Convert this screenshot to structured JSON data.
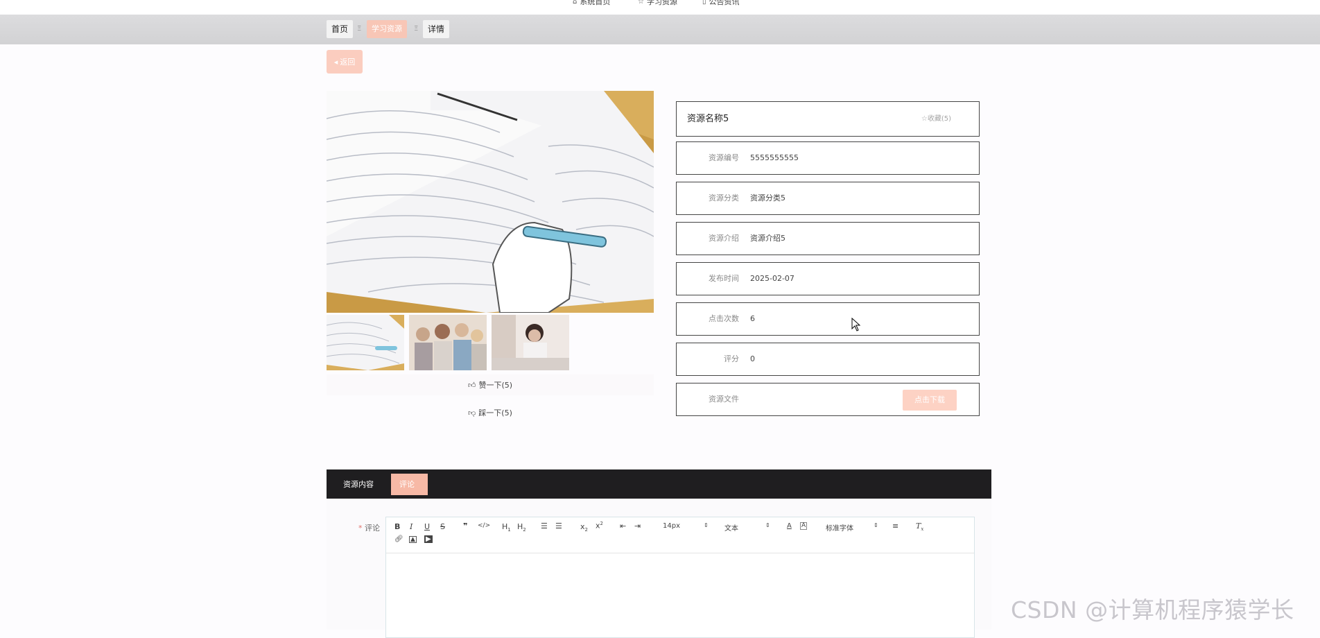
{
  "nav": {
    "items": [
      {
        "icon": "home-icon",
        "label": "系统首页"
      },
      {
        "icon": "star-icon",
        "label": "学习资源"
      },
      {
        "icon": "document-icon",
        "label": "公告资讯"
      }
    ]
  },
  "breadcrumb": {
    "items": [
      "首页",
      "学习资源",
      "详情"
    ],
    "separator": "Ξ"
  },
  "back_button": {
    "label": "返回"
  },
  "resource": {
    "title": "资源名称5",
    "favorite": "收藏(5)",
    "fields": [
      {
        "label": "资源编号",
        "value": "5555555555"
      },
      {
        "label": "资源分类",
        "value": "资源分类5"
      },
      {
        "label": "资源介绍",
        "value": "资源介绍5"
      },
      {
        "label": "发布时间",
        "value": "2025-02-07"
      },
      {
        "label": "点击次数",
        "value": "6"
      },
      {
        "label": "评分",
        "value": "0"
      }
    ],
    "file_label": "资源文件",
    "download_label": "点击下载"
  },
  "votes": {
    "like": "赞一下(5)",
    "dislike": "踩一下(5)"
  },
  "tabs": [
    "资源内容",
    "评论"
  ],
  "comment": {
    "label": "评论",
    "required_mark": "*"
  },
  "editor_toolbar": {
    "font_size": "14px",
    "header": "文本",
    "font_family": "标准字体"
  },
  "watermark": "CSDN @计算机程序猿学长",
  "colors": {
    "accent": "#f8c6b6",
    "tab_bar": "#1f1e20",
    "border": "#444444"
  }
}
